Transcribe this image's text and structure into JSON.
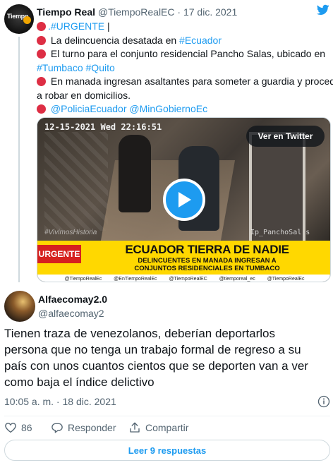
{
  "quoted_tweet": {
    "avatar_text": "Tiempo",
    "author_name": "Tiempo Real",
    "author_handle": "@TiempoRealEC",
    "separator": "·",
    "date": "17 dic. 2021",
    "lines": {
      "l1_link": ".#URGENTE",
      "l1_tail": " |",
      "l2_text": " La delincuencia desatada en ",
      "l2_link": "#Ecuador",
      "l3_text": " El turno para el conjunto residencial Pancho Salas, ubicado en",
      "l4_link_a": "#Tumbaco",
      "l4_space": " ",
      "l4_link_b": "#Quito",
      "l5_text": " En manada ingresan asaltantes para someter a guardia y proceder",
      "l6_text": "a robar en domicilios.",
      "l7_space": " ",
      "l7_link_a": "@PoliciaEcuador",
      "l7_link_b": "@MinGobiernoEc"
    },
    "media": {
      "timestamp": "12-15-2021 Wed 22:16:51",
      "watermark": "#VivimosHistoria",
      "camera_label": "Ip_PanchoSal s",
      "view_button": "Ver en Twitter",
      "banner_tag": "URGENTE",
      "banner_headline": "ECUADOR TIERRA DE NADIE",
      "banner_sub_1": "DELINCUENTES EN MANADA INGRESAN A",
      "banner_sub_2": "CONJUNTOS RESIDENCIALES EN TUMBACO",
      "socials": [
        "@TiempoRealEc",
        "@EnTiempoRealEc",
        "@TiempoRealEC",
        "@tiemporeal_ec",
        "@TiempoRealEc"
      ]
    }
  },
  "reply_tweet": {
    "author_name": "Alfaecomay2.0",
    "author_handle": "@alfaecomay2",
    "text_lines": [
      "Tienen traza de venezolanos, deberían deportarlos",
      "persona que no tenga un trabajo formal de regreso a su",
      "país con unos cuantos cientos que se deporten van a ver",
      "como baja el índice delictivo"
    ],
    "timestamp": "10:05 a. m. · 18 dic. 2021",
    "like_count": "86",
    "reply_label": "Responder",
    "share_label": "Compartir",
    "read_replies_label": "Leer 9 respuestas"
  },
  "colors": {
    "link": "#1d9bf0",
    "red_dot": "#dd2e44",
    "banner_yellow": "#ffd800",
    "banner_red": "#d6211f"
  }
}
